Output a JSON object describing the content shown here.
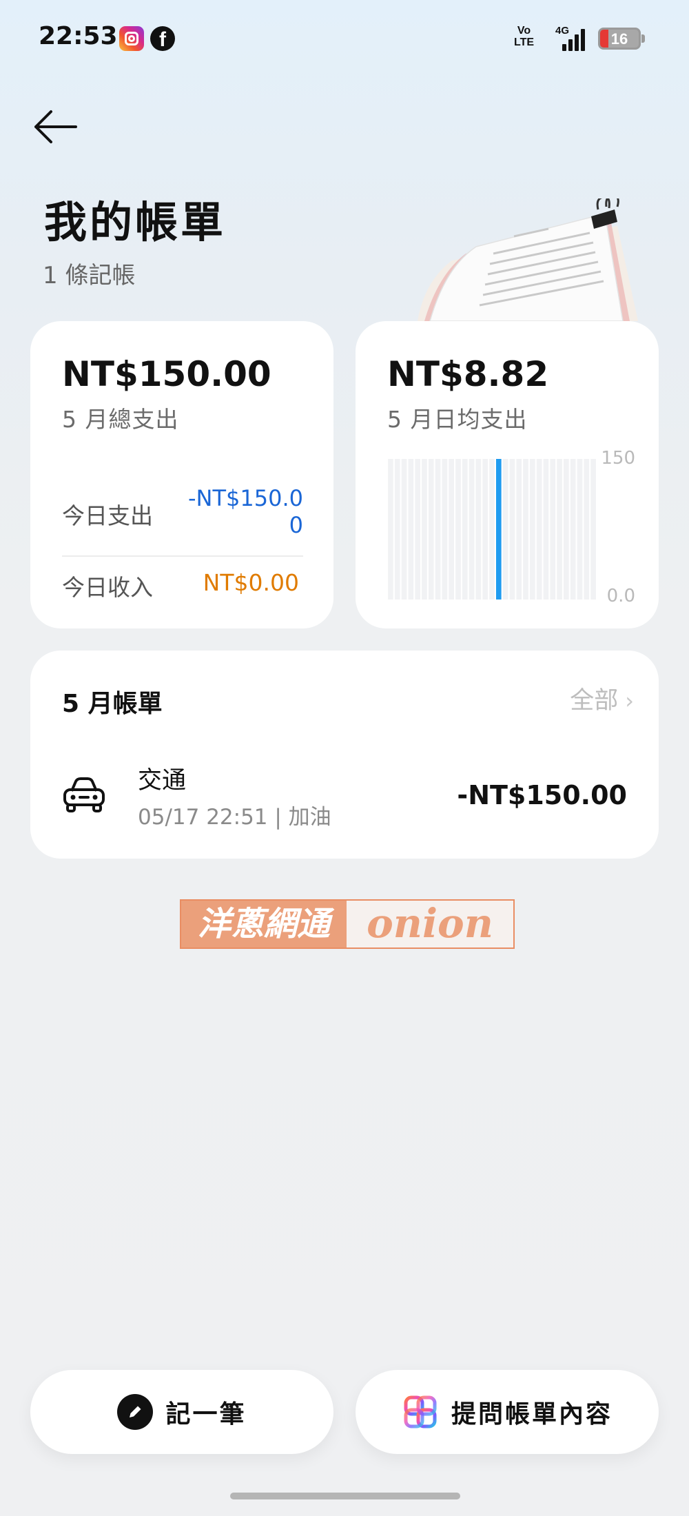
{
  "status_bar": {
    "time": "22:53",
    "network_type": "4G",
    "volte_line1": "Vo",
    "volte_line2": "LTE",
    "battery_level": "16",
    "icons": [
      "instagram-icon",
      "facebook-icon",
      "volte-icon",
      "signal-icon",
      "battery-icon"
    ]
  },
  "header": {
    "back_icon": "arrow-left-icon",
    "title": "我的帳單",
    "subtitle": "1 條記帳"
  },
  "summary": {
    "month_total_amount": "NT$150.00",
    "month_total_caption": "5 月總支出",
    "today_expense_label": "今日支出",
    "today_expense_value": "-NT$150.00",
    "today_income_label": "今日收入",
    "today_income_value": "NT$0.00"
  },
  "daily_average": {
    "amount": "NT$8.82",
    "caption": "5 月日均支出"
  },
  "chart_data": {
    "type": "bar",
    "categories": [
      "1",
      "2",
      "3",
      "4",
      "5",
      "6",
      "7",
      "8",
      "9",
      "10",
      "11",
      "12",
      "13",
      "14",
      "15",
      "16",
      "17",
      "18",
      "19",
      "20",
      "21",
      "22",
      "23",
      "24",
      "25",
      "26",
      "27",
      "28",
      "29",
      "30",
      "31"
    ],
    "values": [
      0,
      0,
      0,
      0,
      0,
      0,
      0,
      0,
      0,
      0,
      0,
      0,
      0,
      0,
      0,
      0,
      150,
      0,
      0,
      0,
      0,
      0,
      0,
      0,
      0,
      0,
      0,
      0,
      0,
      0,
      0
    ],
    "ylim": [
      0,
      150
    ],
    "ytick_labels": [
      "150",
      "0.0"
    ],
    "bar_color": "#1e9bf0",
    "track_color": "#f1f2f4"
  },
  "monthly_bills": {
    "title": "5 月帳單",
    "view_all_label": "全部",
    "transactions": [
      {
        "icon": "car-icon",
        "category": "交通",
        "meta": "05/17 22:51 | 加油",
        "amount": "-NT$150.00"
      }
    ]
  },
  "watermark": {
    "left_text": "洋蔥網通",
    "right_text": "onion"
  },
  "actions": {
    "add_record_label": "記一筆",
    "add_record_icon": "pencil-icon",
    "ask_bill_label": "提問帳單內容",
    "ask_bill_icon": "ai-assistant-icon"
  },
  "colors": {
    "expense_blue": "#1a66d6",
    "income_orange": "#e07b00",
    "chart_bar": "#1e9bf0"
  }
}
